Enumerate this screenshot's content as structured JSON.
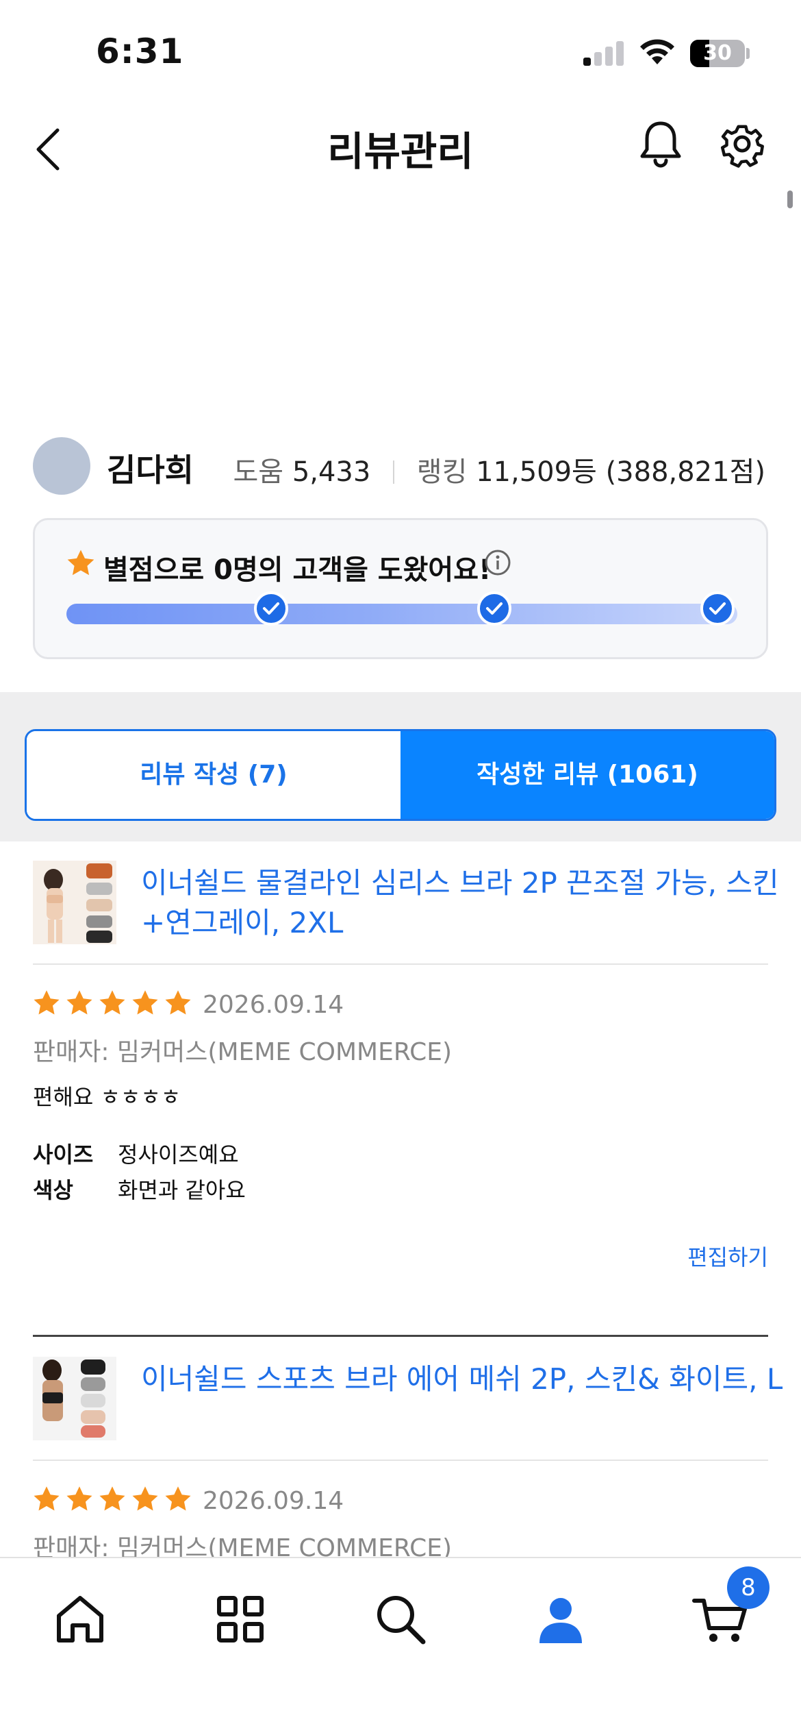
{
  "status_bar": {
    "time": "6:31",
    "battery": "30"
  },
  "header": {
    "title": "리뷰관리"
  },
  "profile": {
    "name": "김다희",
    "help_label": "도움",
    "help_value": "5,433",
    "rank_label": "랭킹",
    "rank_value": "11,509등 (388,821점)"
  },
  "help_card": {
    "text": "별점으로 0명의 고객을 도왔어요!",
    "checkpoints": 3
  },
  "tabs": [
    {
      "label": "리뷰 작성 (7)",
      "active": false
    },
    {
      "label": "작성한 리뷰 (1061)",
      "active": true
    }
  ],
  "reviews": [
    {
      "product_title": "이너쉴드 물결라인 심리스 브라 2P 끈조절 가능, 스킨+연그레이, 2XL",
      "rating": 5,
      "date": "2026.09.14",
      "seller": "판매자: 밈커머스(MEME COMMERCE)",
      "body": "편해요 ㅎㅎㅎㅎ",
      "attributes": [
        {
          "label": "사이즈",
          "value": "정사이즈예요"
        },
        {
          "label": "색상",
          "value": "화면과 같아요"
        }
      ],
      "edit_label": "편집하기"
    },
    {
      "product_title": "이너쉴드 스포츠 브라 에어 메쉬 2P, 스킨& 화이트, L",
      "rating": 5,
      "date": "2026.09.14",
      "seller": "판매자: 밈커머스(MEME COMMERCE)"
    }
  ],
  "bottom_nav": {
    "items": [
      "home-icon",
      "category-icon",
      "search-icon",
      "my-page-icon",
      "cart-icon"
    ],
    "active": "my-page-icon",
    "cart_count": "8"
  },
  "colors": {
    "accent": "#1f6fe8",
    "tab_active": "#0a84ff",
    "star": "#f7931e"
  }
}
